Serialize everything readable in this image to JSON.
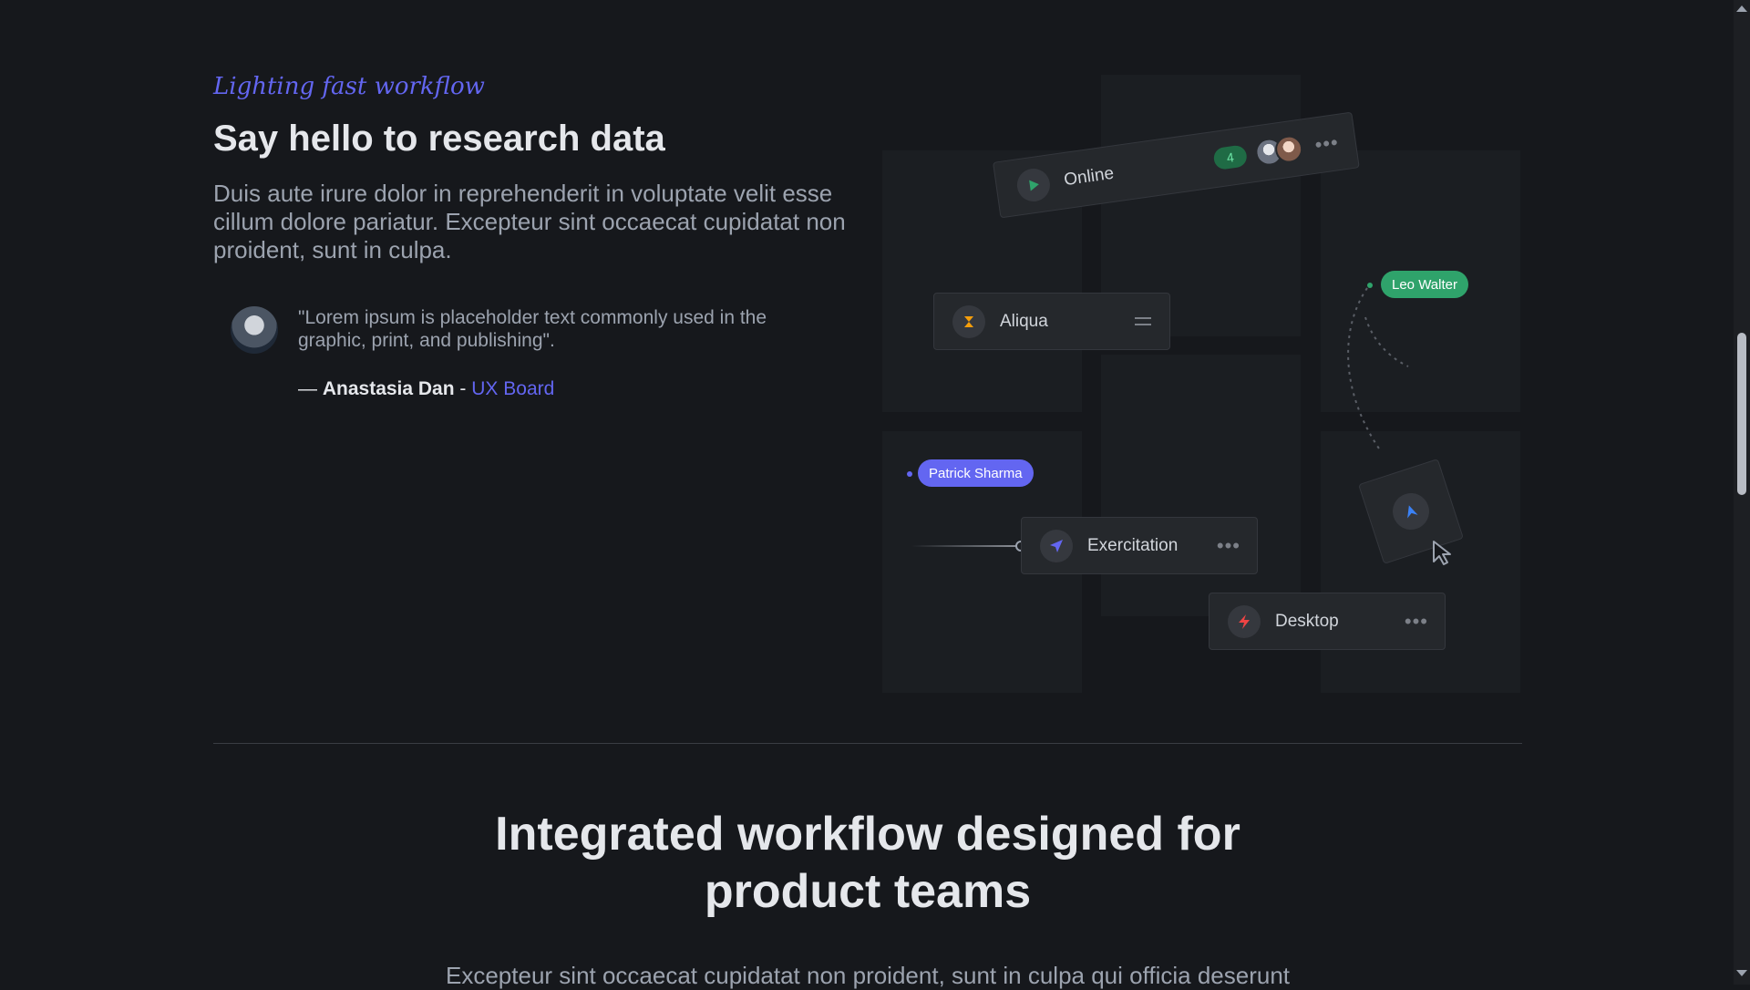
{
  "eyebrow": "Lighting fast workflow",
  "heading": "Say hello to research data",
  "lead": "Duis aute irure dolor in reprehenderit in voluptate velit esse cillum dolore pariatur. Excepteur sint occaecat cupidatat non proident, sunt in culpa.",
  "testimonial": {
    "quote": "\"Lorem ipsum is placeholder text commonly used in the graphic, print, and publishing\".",
    "dash": "— ",
    "author": "Anastasia Dan",
    "sep": " - ",
    "company": "UX Board"
  },
  "workflow": {
    "online": {
      "label": "Online",
      "count": "4"
    },
    "aliqua": {
      "label": "Aliqua"
    },
    "leo": {
      "label": "Leo Walter"
    },
    "patrick": {
      "label": "Patrick Sharma"
    },
    "exercitation": {
      "label": "Exercitation"
    },
    "desktop": {
      "label": "Desktop"
    },
    "colors": {
      "indigo": "#6366f1",
      "green": "#2fa36b",
      "amber": "#f59e0b",
      "red": "#ef4444",
      "sky": "#3b82f6"
    }
  },
  "section2": {
    "title_line1": "Integrated workflow designed for",
    "title_line2": "product teams",
    "subtitle": "Excepteur sint occaecat cupidatat non proident, sunt in culpa qui officia deserunt"
  }
}
